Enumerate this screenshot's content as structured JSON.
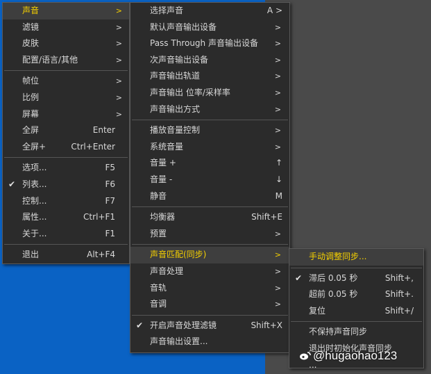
{
  "menu1": {
    "items": [
      {
        "label": "声音",
        "arrow": ">",
        "active": true
      },
      {
        "label": "滤镜",
        "arrow": ">"
      },
      {
        "label": "皮肤",
        "arrow": ">"
      },
      {
        "label": "配置/语言/其他",
        "arrow": ">"
      },
      {
        "label": "帧位",
        "arrow": ">"
      },
      {
        "label": "比例",
        "arrow": ">"
      },
      {
        "label": "屏幕",
        "arrow": ">"
      },
      {
        "label": "全屏",
        "shortcut": "Enter"
      },
      {
        "label": "全屏+",
        "shortcut": "Ctrl+Enter"
      },
      {
        "label": "选项...",
        "shortcut": "F5"
      },
      {
        "label": "列表...",
        "shortcut": "F6",
        "checked": true
      },
      {
        "label": "控制...",
        "shortcut": "F7"
      },
      {
        "label": "属性...",
        "shortcut": "Ctrl+F1"
      },
      {
        "label": "关于...",
        "shortcut": "F1"
      },
      {
        "label": "退出",
        "shortcut": "Alt+F4"
      }
    ]
  },
  "menu2": {
    "items": [
      {
        "label": "选择声音",
        "shortcut": "A >"
      },
      {
        "label": "默认声音输出设备",
        "arrow": ">"
      },
      {
        "label": "Pass Through 声音输出设备",
        "arrow": ">"
      },
      {
        "label": "次声音输出设备",
        "arrow": ">"
      },
      {
        "label": "声音输出轨道",
        "arrow": ">"
      },
      {
        "label": "声音输出 位率/采样率",
        "arrow": ">"
      },
      {
        "label": "声音输出方式",
        "arrow": ">"
      },
      {
        "label": "播放音量控制",
        "arrow": ">"
      },
      {
        "label": "系统音量",
        "arrow": ">"
      },
      {
        "label": "音量 +",
        "shortcut": "↑"
      },
      {
        "label": "音量 -",
        "shortcut": "↓"
      },
      {
        "label": "静音",
        "shortcut": "M"
      },
      {
        "label": "均衡器",
        "shortcut": "Shift+E"
      },
      {
        "label": "预置",
        "arrow": ">"
      },
      {
        "label": "声音匹配(同步)",
        "arrow": ">",
        "active": true
      },
      {
        "label": "声音处理",
        "arrow": ">"
      },
      {
        "label": "音轨",
        "arrow": ">"
      },
      {
        "label": "音调",
        "arrow": ">"
      },
      {
        "label": "开启声音处理滤镜",
        "shortcut": "Shift+X",
        "checked": true
      },
      {
        "label": "声音输出设置..."
      }
    ]
  },
  "menu3": {
    "items": [
      {
        "label": "手动调整同步...",
        "active": true
      },
      {
        "label": "滞后 0.05 秒",
        "shortcut": "Shift+,",
        "checked": true
      },
      {
        "label": "超前 0.05 秒",
        "shortcut": "Shift+."
      },
      {
        "label": "复位",
        "shortcut": "Shift+/"
      },
      {
        "label": "不保持声音同步"
      },
      {
        "label": "退出时初始化声音同步"
      },
      {
        "label": "..."
      }
    ]
  },
  "watermark": "@hugaohao123",
  "colors": {
    "accent": "#f5d000",
    "menu_bg": "#2b2b2b",
    "desktop": "#0a62c4"
  }
}
